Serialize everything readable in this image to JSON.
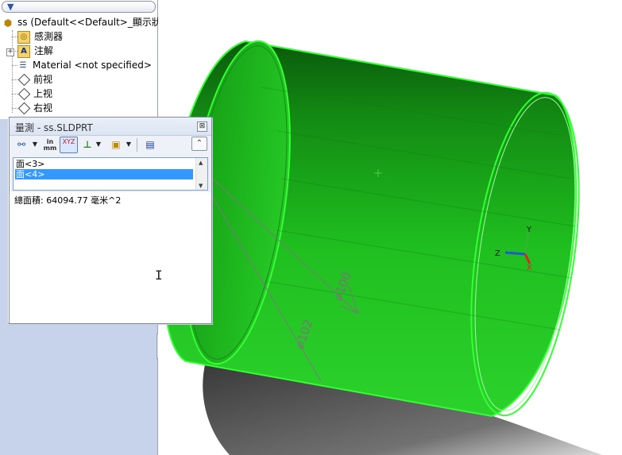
{
  "tree": {
    "filter_icon": "filter-funnel-icon",
    "items": [
      {
        "label": "ss  (Default<<Default>_顯示狀",
        "icon": "part-icon"
      },
      {
        "label": "感測器",
        "icon": "sensor-folder-icon"
      },
      {
        "label": "注解",
        "icon": "annotation-icon"
      },
      {
        "label": "Material <not specified>",
        "icon": "material-icon"
      },
      {
        "label": "前视",
        "icon": "plane-icon"
      },
      {
        "label": "上视",
        "icon": "plane-icon"
      },
      {
        "label": "右视",
        "icon": "plane-icon"
      }
    ]
  },
  "measure": {
    "title": "量測 - ss.SLDPRT",
    "close_glyph": "⊠",
    "toolbar": {
      "arc_circle": "arc-circle-measure-icon",
      "units_top": "in",
      "units_bottom": "mm",
      "xyz": "XYZ",
      "projection": "projection-axis-icon",
      "sensor": "sensor-icon",
      "save": "save-icon",
      "collapse": "⌃"
    },
    "selections": [
      "面<3>",
      "面<4>"
    ],
    "result": "總面積: 64094.77 毫米^2"
  },
  "viewport": {
    "dimensions": [
      "⌀100",
      "⌀102"
    ],
    "triad": {
      "x": "X",
      "y": "Y",
      "z": "Z"
    },
    "colors": {
      "cylinder": "#1fbf1f",
      "highlight": "#33ff33",
      "shadow": "#3a3a3a"
    }
  }
}
